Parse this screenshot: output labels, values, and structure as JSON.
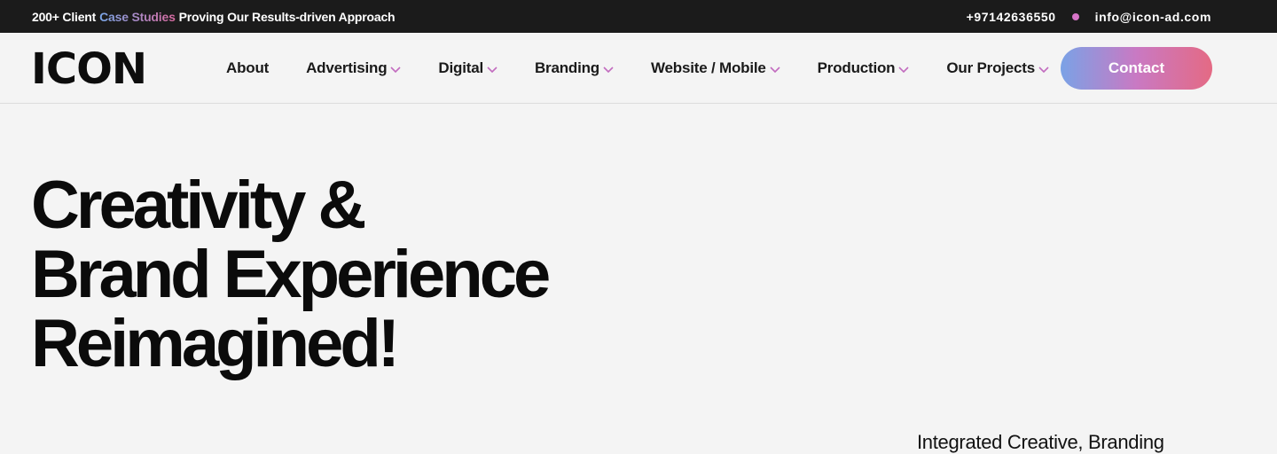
{
  "topbar": {
    "promo_prefix": "200+ Client",
    "promo_accent": "Case Studies",
    "promo_suffix": "Proving Our Results-driven Approach",
    "phone": "+97142636550",
    "email": "info@icon-ad.com"
  },
  "header": {
    "logo": "ICON",
    "nav": [
      {
        "label": "About",
        "has_dropdown": false
      },
      {
        "label": "Advertising",
        "has_dropdown": true
      },
      {
        "label": "Digital",
        "has_dropdown": true
      },
      {
        "label": "Branding",
        "has_dropdown": true
      },
      {
        "label": "Website / Mobile",
        "has_dropdown": true
      },
      {
        "label": "Production",
        "has_dropdown": true
      },
      {
        "label": "Our Projects",
        "has_dropdown": true
      }
    ],
    "contact_label": "Contact"
  },
  "hero": {
    "title_lines": [
      "Creativity &",
      "Brand Experience",
      "Reimagined!"
    ],
    "subtitle": "Integrated Creative, Branding"
  },
  "colors": {
    "topbar_bg": "#1b1b1b",
    "page_bg": "#f4f4f4",
    "accent_blue": "#7aa2e6",
    "accent_pink": "#e46a84",
    "dot": "#d774c8"
  },
  "icons": {
    "dropdown": "chevron-down-icon",
    "separator": "dot-icon"
  }
}
